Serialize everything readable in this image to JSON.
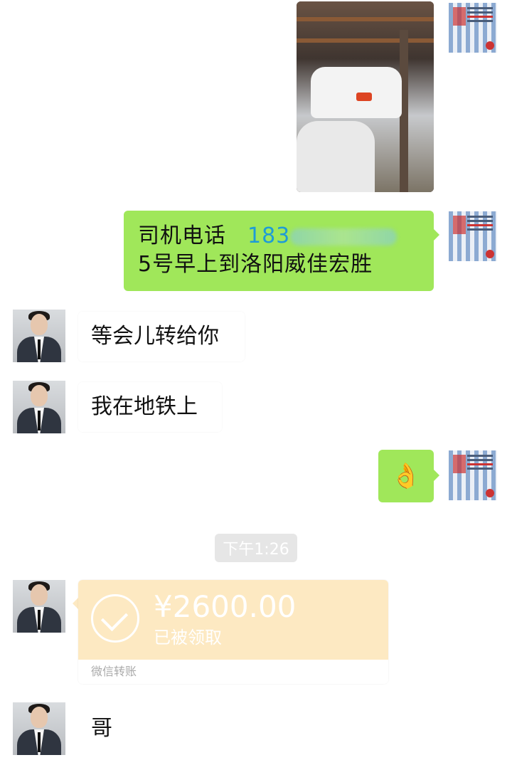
{
  "messages": {
    "phone": {
      "label": "司机电话",
      "number_visible": "183",
      "line2": "5号早上到洛阳威佳宏胜"
    },
    "reply1": "等会儿转给你",
    "reply2": "我在地铁上",
    "emoji": "👌",
    "timestamp": "下午1:26",
    "transfer": {
      "amount": "¥2600.00",
      "status": "已被领取",
      "footer": "微信转账"
    },
    "last": "哥"
  },
  "colors": {
    "sent_bubble": "#a0e75a",
    "received_bubble": "#ffffff",
    "transfer_card": "#fde9c2",
    "phone_link": "#1e9bd7"
  },
  "icons": [
    "contact-avatar",
    "company-logo-avatar",
    "checkmark-circle-icon"
  ]
}
